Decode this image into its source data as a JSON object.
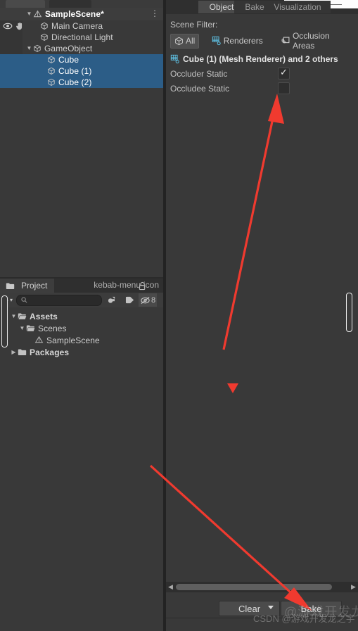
{
  "window": {
    "accent_blue": "#2c5d87",
    "panel_bg": "#393939",
    "arrow_red": "#f03a2f"
  },
  "hierarchy": {
    "scene": {
      "label": "SampleScene*",
      "icon": "unity-scene-icon",
      "menu": "⋮",
      "expand": "▼"
    },
    "visibility_icons": {
      "eye": "eye-icon",
      "hand": "hand-icon"
    },
    "rows": [
      {
        "label": "Main Camera",
        "icon": "gameobject-cube-icon",
        "depth": 2,
        "expand": "",
        "selected": false
      },
      {
        "label": "Directional Light",
        "icon": "gameobject-cube-icon",
        "depth": 2,
        "expand": "",
        "selected": false
      },
      {
        "label": "GameObject",
        "icon": "gameobject-cube-icon",
        "depth": 1,
        "expand": "▼",
        "selected": false
      },
      {
        "label": "Cube",
        "icon": "gameobject-cube-icon",
        "depth": 3,
        "expand": "",
        "selected": true
      },
      {
        "label": "Cube (1)",
        "icon": "gameobject-cube-icon",
        "depth": 3,
        "expand": "",
        "selected": true
      },
      {
        "label": "Cube (2)",
        "icon": "gameobject-cube-icon",
        "depth": 3,
        "expand": "",
        "selected": true
      }
    ]
  },
  "project": {
    "tab_label": "Project",
    "tab_icon": "folder-icon",
    "lock_icon": "lock-open-icon",
    "menu_icon": "kebab-menu-icon",
    "toolbar": {
      "create_label": "+",
      "create_caret": "▾",
      "search_placeholder": "",
      "search_value": "",
      "search_icon": "search-icon",
      "filter_type_icon": "filter-by-type-icon",
      "filter_label_icon": "filter-by-label-icon",
      "hidden_packages_icon": "hidden-packages-icon",
      "hidden_packages_count": "8"
    },
    "tree": [
      {
        "label": "Assets",
        "icon": "folder-open-icon",
        "depth": 1,
        "expand": "▼",
        "bold": true
      },
      {
        "label": "Scenes",
        "icon": "folder-open-icon",
        "depth": 2,
        "expand": "▼",
        "bold": false
      },
      {
        "label": "SampleScene",
        "icon": "unity-scene-icon",
        "depth": 3,
        "expand": "",
        "bold": false
      },
      {
        "label": "Packages",
        "icon": "folder-icon",
        "depth": 1,
        "expand": "▶",
        "bold": true
      }
    ]
  },
  "occlusion": {
    "tabs": [
      {
        "label": "Object",
        "active": true
      },
      {
        "label": "Bake",
        "active": false
      },
      {
        "label": "Visualization",
        "active": false
      }
    ],
    "scene_filter_label": "Scene Filter:",
    "filters": [
      {
        "label": "All",
        "icon": "cube-icon",
        "active": true
      },
      {
        "label": "Renderers",
        "icon": "mesh-renderer-icon",
        "active": false
      },
      {
        "label": "Occlusion Areas",
        "icon": "occlusion-area-icon",
        "active": false
      }
    ],
    "selection_label": "Cube (1) (Mesh Renderer) and 2 others",
    "selection_icon": "mesh-renderer-icon",
    "properties": [
      {
        "name": "Occluder Static",
        "checked": true,
        "check_glyph": "✓"
      },
      {
        "name": "Occludee Static",
        "checked": false,
        "check_glyph": ""
      }
    ],
    "scrollbar": {
      "left_arrow": "◀",
      "right_arrow": "▶"
    },
    "buttons": [
      {
        "label": "Clear",
        "has_dropdown": true
      },
      {
        "label": "Bake",
        "has_dropdown": false
      }
    ]
  },
  "annotations": {
    "arrow_to_occludee_static": "red-arrow-up",
    "arrow_to_bake_button": "red-arrow-down",
    "marker_triangle": "red-triangle-marker"
  },
  "watermark": {
    "text": "CSDN @游戏开发龙之宇",
    "ghost": "@游戏开发龙之宇"
  }
}
